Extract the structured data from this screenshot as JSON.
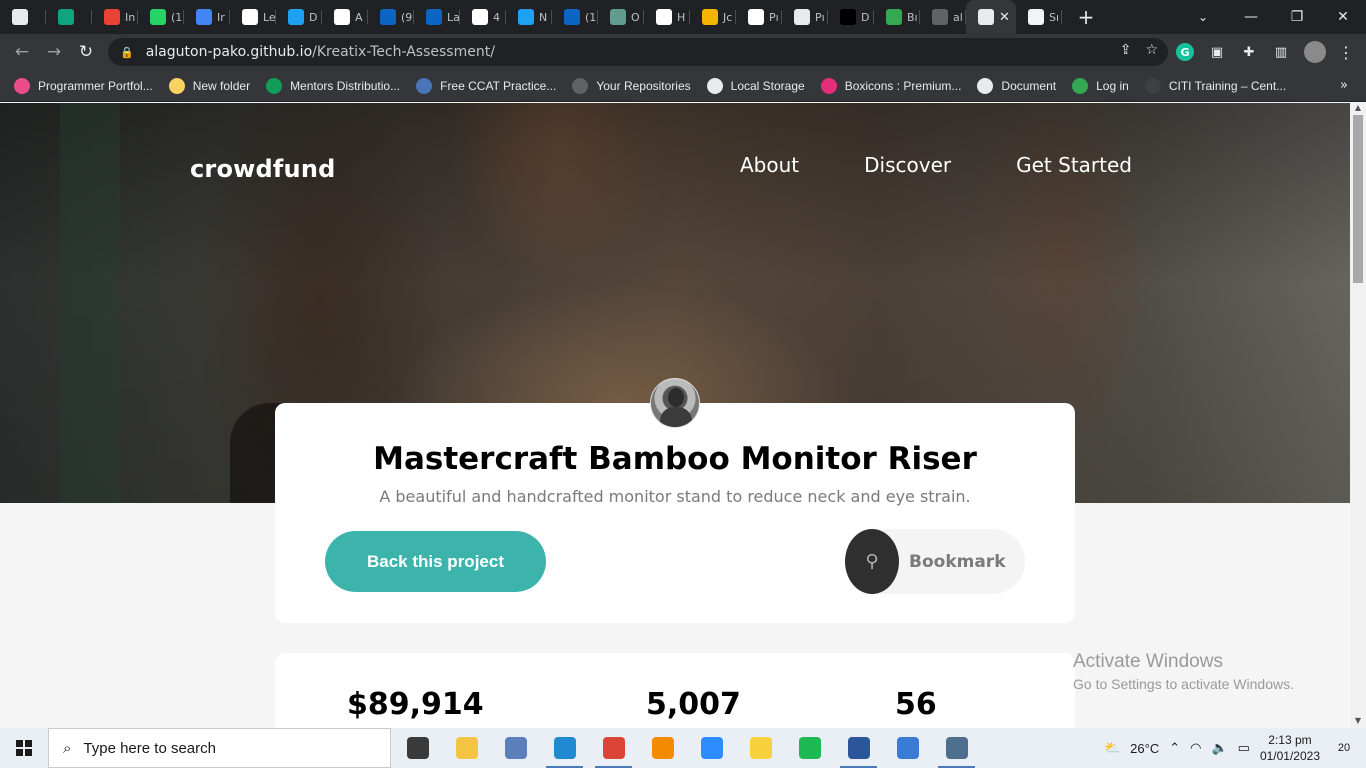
{
  "browser": {
    "tabs": [
      {
        "label": "",
        "color": "#e8eaed"
      },
      {
        "label": "",
        "color": "#10a37f"
      },
      {
        "label": "In",
        "color": "#ea4335"
      },
      {
        "label": "(1",
        "color": "#25d366"
      },
      {
        "label": "Ir",
        "color": "#4285f4"
      },
      {
        "label": "Le",
        "color": "#ffffff"
      },
      {
        "label": "D",
        "color": "#1da1f2"
      },
      {
        "label": "A",
        "color": "#ffffff"
      },
      {
        "label": "(9",
        "color": "#0a66c2"
      },
      {
        "label": "La",
        "color": "#0a66c2"
      },
      {
        "label": "4",
        "color": "#ffffff"
      },
      {
        "label": "N",
        "color": "#1da1f2"
      },
      {
        "label": "(1",
        "color": "#0a66c2"
      },
      {
        "label": "O",
        "color": "#5f9e8f"
      },
      {
        "label": "H",
        "color": "#ffffff"
      },
      {
        "label": "Jc",
        "color": "#f4b400"
      },
      {
        "label": "Pı",
        "color": "#ffffff"
      },
      {
        "label": "Pı",
        "color": "#e8eaed"
      },
      {
        "label": "D",
        "color": "#000000"
      },
      {
        "label": "Bı",
        "color": "#34a853"
      },
      {
        "label": "al",
        "color": "#5f6368"
      }
    ],
    "active_tab": {
      "label": "",
      "color": "#e8eaed",
      "close": "✕"
    },
    "last_tab": {
      "label": "Sı",
      "color": "#f1f3f4"
    },
    "new_tab": "+",
    "url_host": "alaguton-pako.github.io",
    "url_path": "/Kreatix-Tech-Assessment/",
    "bookmarks": [
      {
        "label": "Programmer Portfol...",
        "color": "#ea4c89"
      },
      {
        "label": "New folder",
        "color": "#f9d262"
      },
      {
        "label": "Mentors Distributio...",
        "color": "#0f9d58"
      },
      {
        "label": "Free CCAT Practice...",
        "color": "#4a73b8"
      },
      {
        "label": "Your Repositories",
        "color": "#5f6368"
      },
      {
        "label": "Local Storage",
        "color": "#e8eaed"
      },
      {
        "label": "Boxicons : Premium...",
        "color": "#e42d7b"
      },
      {
        "label": "Document",
        "color": "#e8eaed"
      },
      {
        "label": "Log in",
        "color": "#34a853"
      },
      {
        "label": "CITI Training – Cent...",
        "color": "#3c4043"
      }
    ]
  },
  "page": {
    "logo": "crowdfund",
    "nav": [
      "About",
      "Discover",
      "Get Started"
    ],
    "project_title": "Mastercraft Bamboo Monitor Riser",
    "project_subtitle": "A beautiful and handcrafted monitor stand to reduce neck and eye strain.",
    "back_button": "Back this project",
    "bookmark_button": "Bookmark",
    "stats": [
      "$89,914",
      "5,007",
      "56"
    ],
    "accent_color": "#3cb4ac"
  },
  "watermark": {
    "line1": "Activate Windows",
    "line2": "Go to Settings to activate Windows."
  },
  "taskbar": {
    "search_placeholder": "Type here to search",
    "weather": "26°C",
    "time": "2:13 pm",
    "date": "01/01/2023",
    "notifications": "20",
    "apps": [
      {
        "name": "task-view",
        "color": "#3a3a3a",
        "open": false
      },
      {
        "name": "file-explorer",
        "color": "#f4c542",
        "open": false
      },
      {
        "name": "app-window",
        "color": "#5b7fb8",
        "open": false
      },
      {
        "name": "vscode",
        "color": "#1f8ad2",
        "open": true
      },
      {
        "name": "chrome",
        "color": "#db4437",
        "open": true
      },
      {
        "name": "vlc",
        "color": "#f28b00",
        "open": false
      },
      {
        "name": "zoom",
        "color": "#2d8cff",
        "open": false
      },
      {
        "name": "sticky-notes",
        "color": "#f7d23e",
        "open": false
      },
      {
        "name": "spotify",
        "color": "#1db954",
        "open": false
      },
      {
        "name": "word",
        "color": "#2b579a",
        "open": true
      },
      {
        "name": "anydesk",
        "color": "#3a7bd5",
        "open": false
      },
      {
        "name": "calculator",
        "color": "#4f6f8f",
        "open": true
      }
    ]
  }
}
